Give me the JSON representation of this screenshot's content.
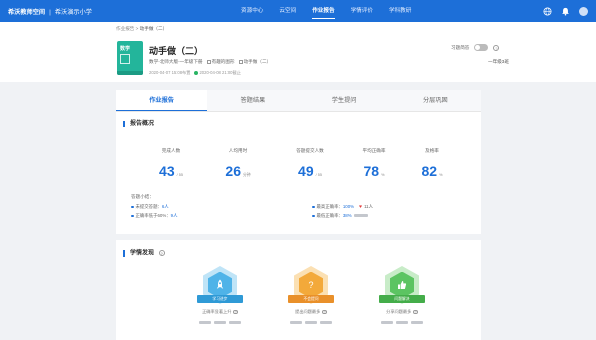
{
  "topbar": {
    "brand": "希沃教师空间",
    "separator": "|",
    "school": "希沃演示小学",
    "nav": [
      "资源中心",
      "云空间",
      "作业报告",
      "学情评价",
      "学科教研"
    ],
    "active_nav": 2,
    "icons": [
      "globe-icon",
      "bell-icon",
      "avatar"
    ]
  },
  "header": {
    "breadcrumb_root": "作业报告",
    "breadcrumb_sep": ">",
    "breadcrumb_current": "动手做（二）",
    "title": "动手做（二）",
    "subject_line": "数学-北师大版-一年级下册",
    "tag1": "有趣的图形",
    "tag2": "动手做（二）",
    "assigned": "2020-04-07 15:08布置",
    "deadline": "2020-04-08 21:00截止",
    "toggle_label": "习题简答",
    "class_name": "一年级3班"
  },
  "tabs": [
    "作业报告",
    "答题结果",
    "学生提问",
    "分层巩固"
  ],
  "overview": {
    "section_title": "报告概况",
    "stats": [
      {
        "label": "完成人数",
        "value": "43",
        "unit": "/ 55"
      },
      {
        "label": "人均用时",
        "value": "26",
        "unit": "分钟"
      },
      {
        "label": "答题提交人数",
        "value": "49",
        "unit": "/ 55"
      },
      {
        "label": "平均正确率",
        "value": "78",
        "unit": "%"
      },
      {
        "label": "及格率",
        "value": "82",
        "unit": "%"
      }
    ],
    "summary_title": "答题小结：",
    "summary": {
      "unsubmitted_label": "未提交答题：",
      "unsubmitted_value": "6人",
      "low_label": "正确率低于60%：",
      "low_value": "9人",
      "highest_label": "最高正确率：",
      "highest_value": "100%",
      "likes": "11人",
      "lowest_label": "最低正确率：",
      "lowest_value": "38%"
    }
  },
  "findings": {
    "section_title": "学情发现",
    "badges": [
      {
        "ribbon": "学习进步",
        "caption": "正确率显著上升",
        "color": "#4fb3e8",
        "icon": "rocket-icon"
      },
      {
        "ribbon": "不会提问",
        "caption": "提出问题最多",
        "color": "#f3a93a",
        "icon": "question-icon"
      },
      {
        "ribbon": "问题解决",
        "caption": "分享问题最多",
        "color": "#5cc462",
        "icon": "thumbs-up-icon"
      }
    ]
  }
}
